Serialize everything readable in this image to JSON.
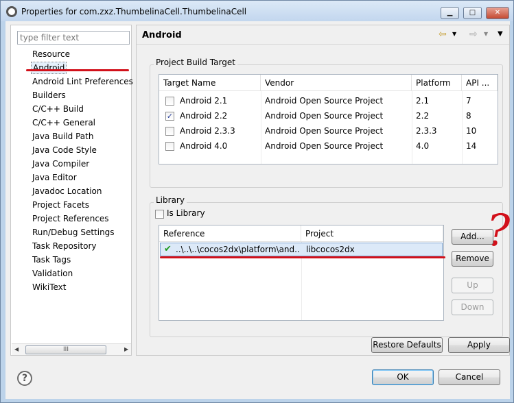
{
  "window": {
    "title": "Properties for com.zxz.ThumbelinaCell.ThumbelinaCell",
    "controls": {
      "minimize": "▁",
      "maximize": "□",
      "close": "✕"
    }
  },
  "sidebar": {
    "filter_placeholder": "type filter text",
    "items": [
      "Resource",
      "Android",
      "Android Lint Preferences",
      "Builders",
      "C/C++ Build",
      "C/C++ General",
      "Java Build Path",
      "Java Code Style",
      "Java Compiler",
      "Java Editor",
      "Javadoc Location",
      "Project Facets",
      "Project References",
      "Run/Debug Settings",
      "Task Repository",
      "Task Tags",
      "Validation",
      "WikiText"
    ],
    "selected": "Android",
    "scroll_thumb": "III"
  },
  "page": {
    "title": "Android",
    "nav": {
      "back": "⇦",
      "forward": "⇨",
      "menu": "▼"
    }
  },
  "build_target": {
    "label": "Project Build Target",
    "columns": [
      "Target Name",
      "Vendor",
      "Platform",
      "API ..."
    ],
    "rows": [
      {
        "name": "Android 2.1",
        "vendor": "Android Open Source Project",
        "platform": "2.1",
        "api": "7",
        "checked": false
      },
      {
        "name": "Android 2.2",
        "vendor": "Android Open Source Project",
        "platform": "2.2",
        "api": "8",
        "checked": true
      },
      {
        "name": "Android 2.3.3",
        "vendor": "Android Open Source Project",
        "platform": "2.3.3",
        "api": "10",
        "checked": false
      },
      {
        "name": "Android 4.0",
        "vendor": "Android Open Source Project",
        "platform": "4.0",
        "api": "14",
        "checked": false
      }
    ]
  },
  "library": {
    "label": "Library",
    "is_library_label": "Is Library",
    "is_library_checked": false,
    "columns": [
      "Reference",
      "Project"
    ],
    "rows": [
      {
        "reference": "..\\..\\..\\cocos2dx\\platform\\and...",
        "project": "libcocos2dx",
        "status": "ok"
      }
    ],
    "buttons": {
      "add": "Add...",
      "remove": "Remove",
      "up": "Up",
      "down": "Down"
    }
  },
  "buttons": {
    "restore_defaults": "Restore Defaults",
    "apply": "Apply",
    "ok": "OK",
    "cancel": "Cancel",
    "help": "?"
  },
  "annotations": {
    "question_mark": "?"
  },
  "colors": {
    "annotation_red": "#d2101a",
    "selection": "#dce9f8",
    "check_green": "#1e9a1e"
  }
}
